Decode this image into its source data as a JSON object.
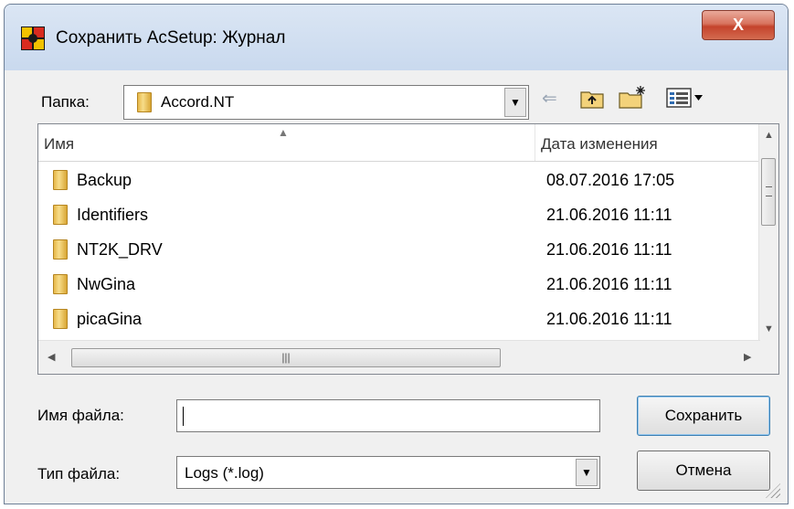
{
  "window": {
    "title": "Сохранить AcSetup: Журнал",
    "close_label": "X"
  },
  "folder_bar": {
    "label": "Папка:",
    "current_folder": "Accord.NT"
  },
  "toolbar": {
    "back_icon": "back-arrow-icon",
    "up_icon": "folder-up-icon",
    "new_folder_icon": "new-folder-icon",
    "view_icon": "view-menu-icon"
  },
  "file_list": {
    "columns": {
      "name": "Имя",
      "date": "Дата изменения"
    },
    "rows": [
      {
        "name": "Backup",
        "date": "08.07.2016 17:05"
      },
      {
        "name": "Identifiers",
        "date": "21.06.2016 11:11"
      },
      {
        "name": "NT2K_DRV",
        "date": "21.06.2016 11:11"
      },
      {
        "name": "NwGina",
        "date": "21.06.2016 11:11"
      },
      {
        "name": "picaGina",
        "date": "21.06.2016 11:11"
      }
    ]
  },
  "filename": {
    "label": "Имя файла:",
    "value": ""
  },
  "filetype": {
    "label": "Тип файла:",
    "value": "Logs (*.log)"
  },
  "buttons": {
    "save": "Сохранить",
    "cancel": "Отмена"
  },
  "colors": {
    "title_bar": "#c9d9ee",
    "close_button": "#c4432c",
    "dialog_bg": "#f0f0f0"
  }
}
